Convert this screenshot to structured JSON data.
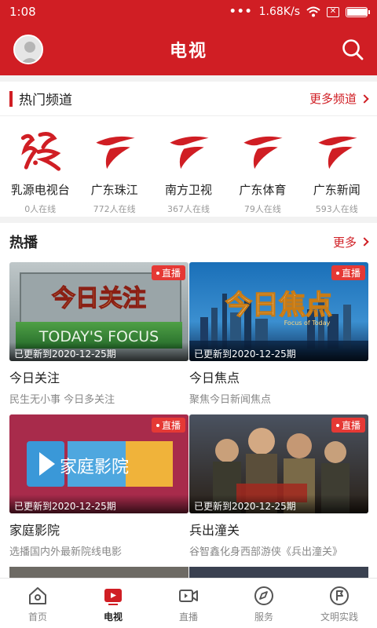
{
  "status": {
    "time": "1:08",
    "speed": "1.68K/s",
    "battery_level": 0.95
  },
  "header": {
    "title": "电视"
  },
  "hot_channels": {
    "title": "热门频道",
    "more": "更多频道",
    "items": [
      {
        "name": "乳源电视台",
        "count": "0人在线",
        "icon": "ruyuan-tv-logo"
      },
      {
        "name": "广东珠江",
        "count": "772人在线",
        "icon": "guangdong-tv-logo"
      },
      {
        "name": "南方卫视",
        "count": "367人在线",
        "icon": "guangdong-tv-logo"
      },
      {
        "name": "广东体育",
        "count": "79人在线",
        "icon": "guangdong-tv-logo"
      },
      {
        "name": "广东新闻",
        "count": "593人在线",
        "icon": "guangdong-tv-logo"
      }
    ]
  },
  "hot_play": {
    "title": "热播",
    "more": "更多",
    "live_label": "直播",
    "items": [
      {
        "title": "今日关注",
        "subtitle": "民生无小事 今日多关注",
        "update": "已更新到2020-12-25期",
        "overlay": "今日关注",
        "overlay_en": "TODAY'S FOCUS"
      },
      {
        "title": "今日焦点",
        "subtitle": "聚焦今日新闻焦点",
        "update": "已更新到2020-12-25期",
        "overlay": "今日焦点",
        "overlay_en": "Focus of Today"
      },
      {
        "title": "家庭影院",
        "subtitle": "选播国内外最新院线电影",
        "update": "已更新到2020-12-25期",
        "overlay": "家庭影院"
      },
      {
        "title": "兵出潼关",
        "subtitle": "谷智鑫化身西部游侠《兵出潼关》",
        "update": "已更新到2020-12-25期"
      }
    ]
  },
  "nav": {
    "items": [
      {
        "label": "首页",
        "icon": "home-icon"
      },
      {
        "label": "电视",
        "icon": "tv-icon",
        "active": true
      },
      {
        "label": "直播",
        "icon": "live-camera-icon"
      },
      {
        "label": "服务",
        "icon": "compass-icon"
      },
      {
        "label": "文明实践",
        "icon": "flag-icon"
      }
    ]
  },
  "colors": {
    "primary": "#d01e24",
    "live": "#e53935"
  }
}
